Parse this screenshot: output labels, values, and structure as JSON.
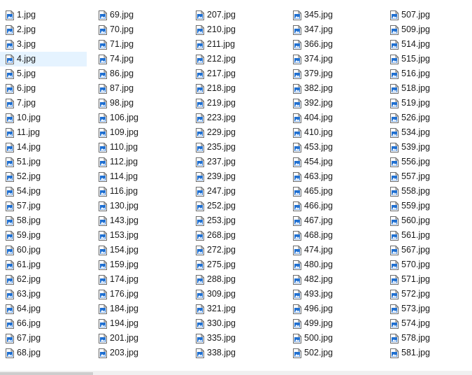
{
  "columns": [
    {
      "items": [
        "1.jpg",
        "2.jpg",
        "3.jpg",
        "4.jpg",
        "5.jpg",
        "6.jpg",
        "7.jpg",
        "10.jpg",
        "11.jpg",
        "14.jpg",
        "51.jpg",
        "52.jpg",
        "54.jpg",
        "57.jpg",
        "58.jpg",
        "59.jpg",
        "60.jpg",
        "61.jpg",
        "62.jpg",
        "63.jpg",
        "64.jpg",
        "66.jpg",
        "67.jpg",
        "68.jpg"
      ]
    },
    {
      "items": [
        "69.jpg",
        "70.jpg",
        "71.jpg",
        "74.jpg",
        "86.jpg",
        "87.jpg",
        "98.jpg",
        "106.jpg",
        "109.jpg",
        "110.jpg",
        "112.jpg",
        "114.jpg",
        "116.jpg",
        "130.jpg",
        "143.jpg",
        "153.jpg",
        "154.jpg",
        "159.jpg",
        "174.jpg",
        "176.jpg",
        "184.jpg",
        "194.jpg",
        "201.jpg",
        "203.jpg"
      ]
    },
    {
      "items": [
        "207.jpg",
        "210.jpg",
        "211.jpg",
        "212.jpg",
        "217.jpg",
        "218.jpg",
        "219.jpg",
        "223.jpg",
        "229.jpg",
        "235.jpg",
        "237.jpg",
        "239.jpg",
        "247.jpg",
        "252.jpg",
        "253.jpg",
        "268.jpg",
        "272.jpg",
        "275.jpg",
        "288.jpg",
        "309.jpg",
        "321.jpg",
        "330.jpg",
        "335.jpg",
        "338.jpg"
      ]
    },
    {
      "items": [
        "345.jpg",
        "347.jpg",
        "366.jpg",
        "374.jpg",
        "379.jpg",
        "382.jpg",
        "392.jpg",
        "404.jpg",
        "410.jpg",
        "453.jpg",
        "454.jpg",
        "463.jpg",
        "465.jpg",
        "466.jpg",
        "467.jpg",
        "468.jpg",
        "474.jpg",
        "480.jpg",
        "482.jpg",
        "493.jpg",
        "496.jpg",
        "499.jpg",
        "500.jpg",
        "502.jpg"
      ]
    },
    {
      "items": [
        "507.jpg",
        "509.jpg",
        "514.jpg",
        "515.jpg",
        "516.jpg",
        "518.jpg",
        "519.jpg",
        "526.jpg",
        "534.jpg",
        "539.jpg",
        "556.jpg",
        "557.jpg",
        "558.jpg",
        "559.jpg",
        "560.jpg",
        "561.jpg",
        "567.jpg",
        "570.jpg",
        "571.jpg",
        "572.jpg",
        "573.jpg",
        "574.jpg",
        "578.jpg",
        "581.jpg"
      ]
    }
  ],
  "selected": {
    "column": 0,
    "index": 3
  },
  "icon": "jpg-image-file-icon",
  "colors": {
    "selection": "#e5f3ff",
    "icon_blue": "#1f6fd0",
    "text": "#1a1a1a"
  }
}
